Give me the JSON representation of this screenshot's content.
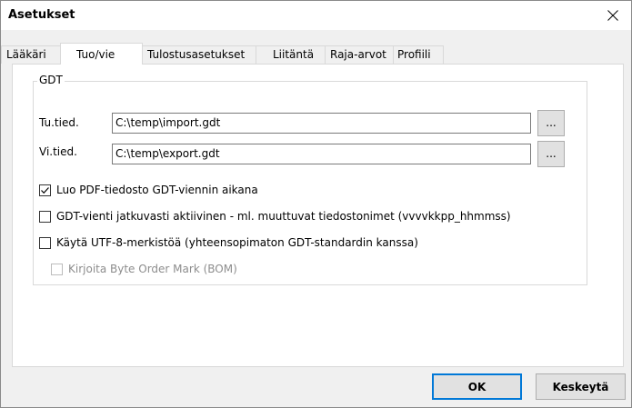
{
  "window": {
    "title": "Asetukset"
  },
  "tabs": [
    {
      "label": "Lääkäri"
    },
    {
      "label": "Tuo/vie"
    },
    {
      "label": "Tulostusasetukset"
    },
    {
      "label": "Liitäntä"
    },
    {
      "label": "Raja-arvot"
    },
    {
      "label": "Profiili"
    }
  ],
  "gdt": {
    "group_label": "GDT",
    "import_label": "Tu.tied.",
    "import_value": "C:\\temp\\import.gdt",
    "export_label": "Vi.tied.",
    "export_value": "C:\\temp\\export.gdt",
    "browse_label": "...",
    "options": [
      {
        "label": "Luo PDF-tiedosto GDT-viennin aikana",
        "checked": true,
        "enabled": true
      },
      {
        "label": "GDT-vienti jatkuvasti aktiivinen - ml. muuttuvat tiedostonimet (vvvvkkpp_hhmmss)",
        "checked": false,
        "enabled": true
      },
      {
        "label": "Käytä UTF-8-merkistöä (yhteensopimaton GDT-standardin kanssa)",
        "checked": false,
        "enabled": true
      },
      {
        "label": "Kirjoita Byte Order Mark (BOM)",
        "checked": false,
        "enabled": false
      }
    ]
  },
  "buttons": {
    "ok_label": "OK",
    "cancel_label": "Keskeytä"
  }
}
